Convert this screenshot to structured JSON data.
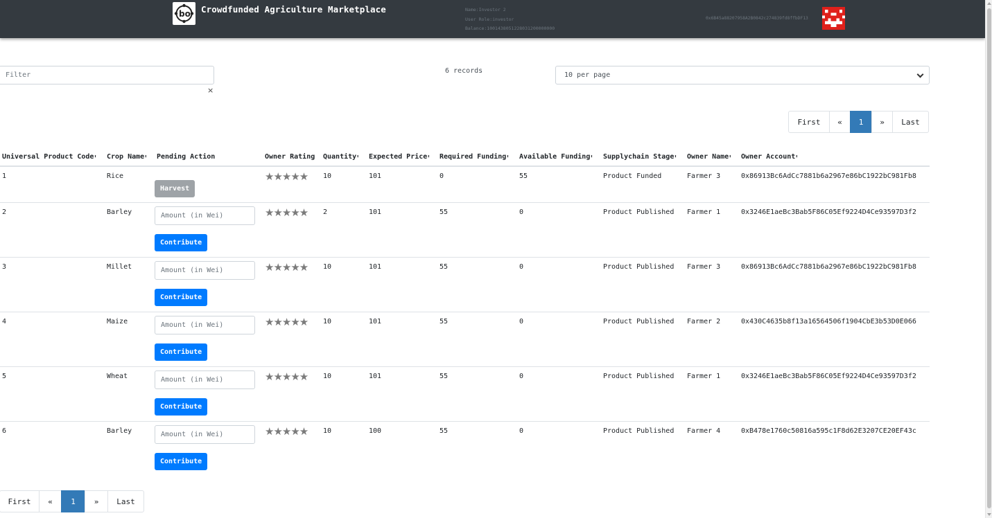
{
  "header": {
    "title": "Crowdfunded Agriculture Marketplace",
    "user_name": "Name:Investor 2",
    "user_role": "User Role:investor",
    "balance": "Balance:1001438051228031200000000",
    "account": "0x6B45a88207958A2B0842c274839fd8ffbDF13",
    "colors": {
      "bar": "#343a40",
      "identicon": "#e0201b"
    }
  },
  "controls": {
    "filter_placeholder": "Filter",
    "clear_symbol": "×",
    "records": "6 records",
    "per_page": "10 per page"
  },
  "pagination": {
    "first": "First",
    "prev": "«",
    "current": "1",
    "next": "»",
    "last": "Last"
  },
  "table": {
    "sort_symbol": "⬍",
    "columns": [
      "Universal Product Code",
      "Crop Name",
      "Pending Action",
      "Owner Rating",
      "Quantity",
      "Expected Price",
      "Required Funding",
      "Available Funding",
      "Supplychain Stage",
      "Owner Name",
      "Owner Account"
    ],
    "amount_placeholder": "Amount (in Wei)",
    "stars": "★★★★★",
    "rows": [
      {
        "upc": "1",
        "crop": "Rice",
        "action": "Harvest",
        "quantity": "10",
        "price": "101",
        "required": "0",
        "available": "55",
        "stage": "Product Funded",
        "owner": "Farmer 3",
        "account": "0x86913Bc6AdCc7881b6a2967e86bC1922bC981Fb8"
      },
      {
        "upc": "2",
        "crop": "Barley",
        "action": "Contribute",
        "quantity": "2",
        "price": "101",
        "required": "55",
        "available": "0",
        "stage": "Product Published",
        "owner": "Farmer 1",
        "account": "0x3246E1aeBc3Bab5F86C05Ef9224D4Ce93597D3f2"
      },
      {
        "upc": "3",
        "crop": "Millet",
        "action": "Contribute",
        "quantity": "10",
        "price": "101",
        "required": "55",
        "available": "0",
        "stage": "Product Published",
        "owner": "Farmer 3",
        "account": "0x86913Bc6AdCc7881b6a2967e86bC1922bC981Fb8"
      },
      {
        "upc": "4",
        "crop": "Maize",
        "action": "Contribute",
        "quantity": "10",
        "price": "101",
        "required": "55",
        "available": "0",
        "stage": "Product Published",
        "owner": "Farmer 2",
        "account": "0x430C4635b8f13a16564506f1904CbE3b53D0E066"
      },
      {
        "upc": "5",
        "crop": "Wheat",
        "action": "Contribute",
        "quantity": "10",
        "price": "101",
        "required": "55",
        "available": "0",
        "stage": "Product Published",
        "owner": "Farmer 1",
        "account": "0x3246E1aeBc3Bab5F86C05Ef9224D4Ce93597D3f2"
      },
      {
        "upc": "6",
        "crop": "Barley",
        "action": "Contribute",
        "quantity": "10",
        "price": "100",
        "required": "55",
        "available": "0",
        "stage": "Product Published",
        "owner": "Farmer 4",
        "account": "0xB478e1760c50816a595c1F8d62E3207CE20EF43c"
      }
    ]
  }
}
